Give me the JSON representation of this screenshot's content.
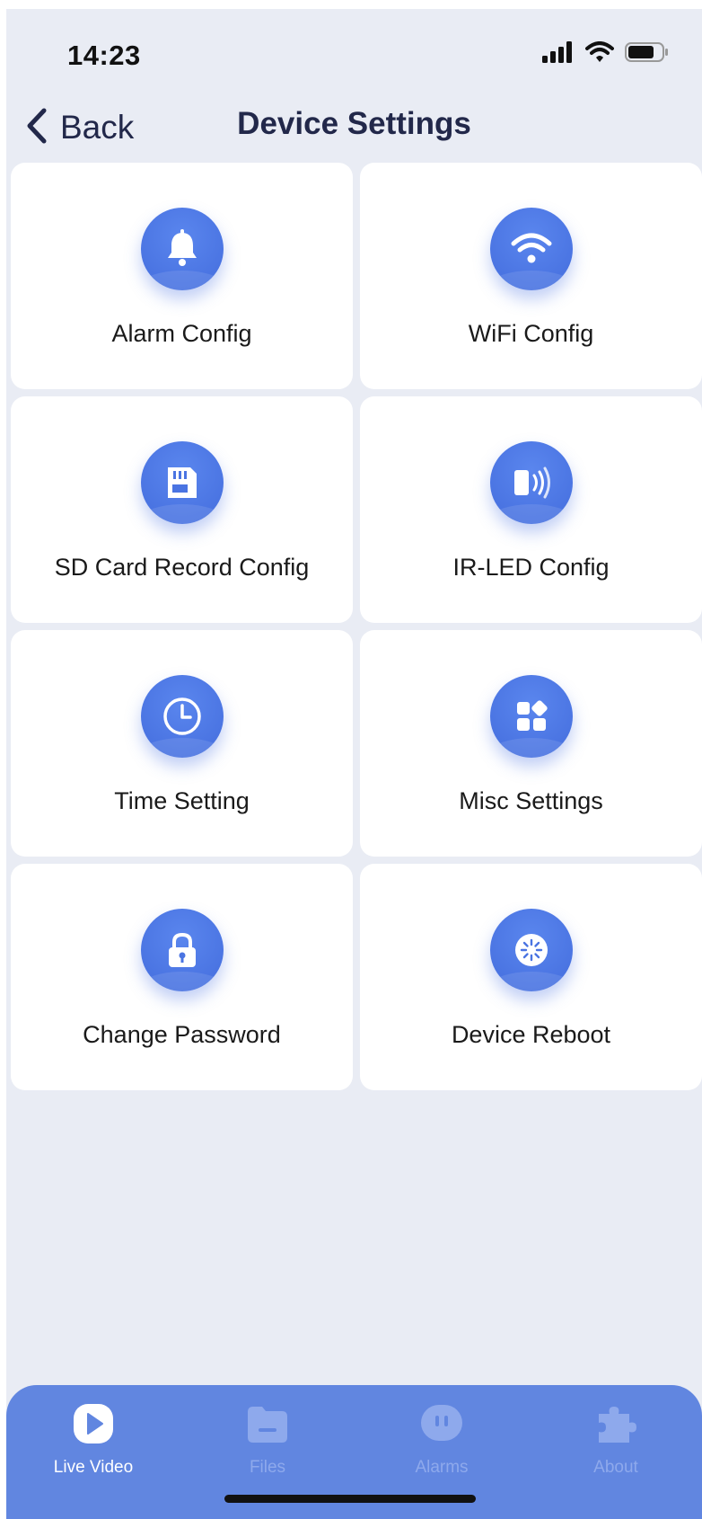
{
  "status_bar": {
    "time": "14:23"
  },
  "nav": {
    "back_label": "Back",
    "title": "Device Settings"
  },
  "settings": [
    {
      "label": "Alarm Config",
      "icon": "bell-icon"
    },
    {
      "label": "WiFi Config",
      "icon": "wifi-icon"
    },
    {
      "label": "SD Card Record Config",
      "icon": "sd-card-icon"
    },
    {
      "label": "IR-LED Config",
      "icon": "ir-led-icon"
    },
    {
      "label": "Time Setting",
      "icon": "clock-icon"
    },
    {
      "label": "Misc Settings",
      "icon": "grid-icon"
    },
    {
      "label": "Change Password",
      "icon": "lock-icon"
    },
    {
      "label": "Device Reboot",
      "icon": "reboot-icon"
    }
  ],
  "tabbar": {
    "tabs": [
      {
        "label": "Live Video",
        "icon": "play-icon",
        "active": true
      },
      {
        "label": "Files",
        "icon": "folder-icon",
        "active": false
      },
      {
        "label": "Alarms",
        "icon": "alarm-icon",
        "active": false
      },
      {
        "label": "About",
        "icon": "puzzle-icon",
        "active": false
      }
    ]
  },
  "colors": {
    "accent": "#4a74e2",
    "background": "#e9ecf4",
    "tabbar": "#6186e0",
    "title_text": "#22284a"
  }
}
